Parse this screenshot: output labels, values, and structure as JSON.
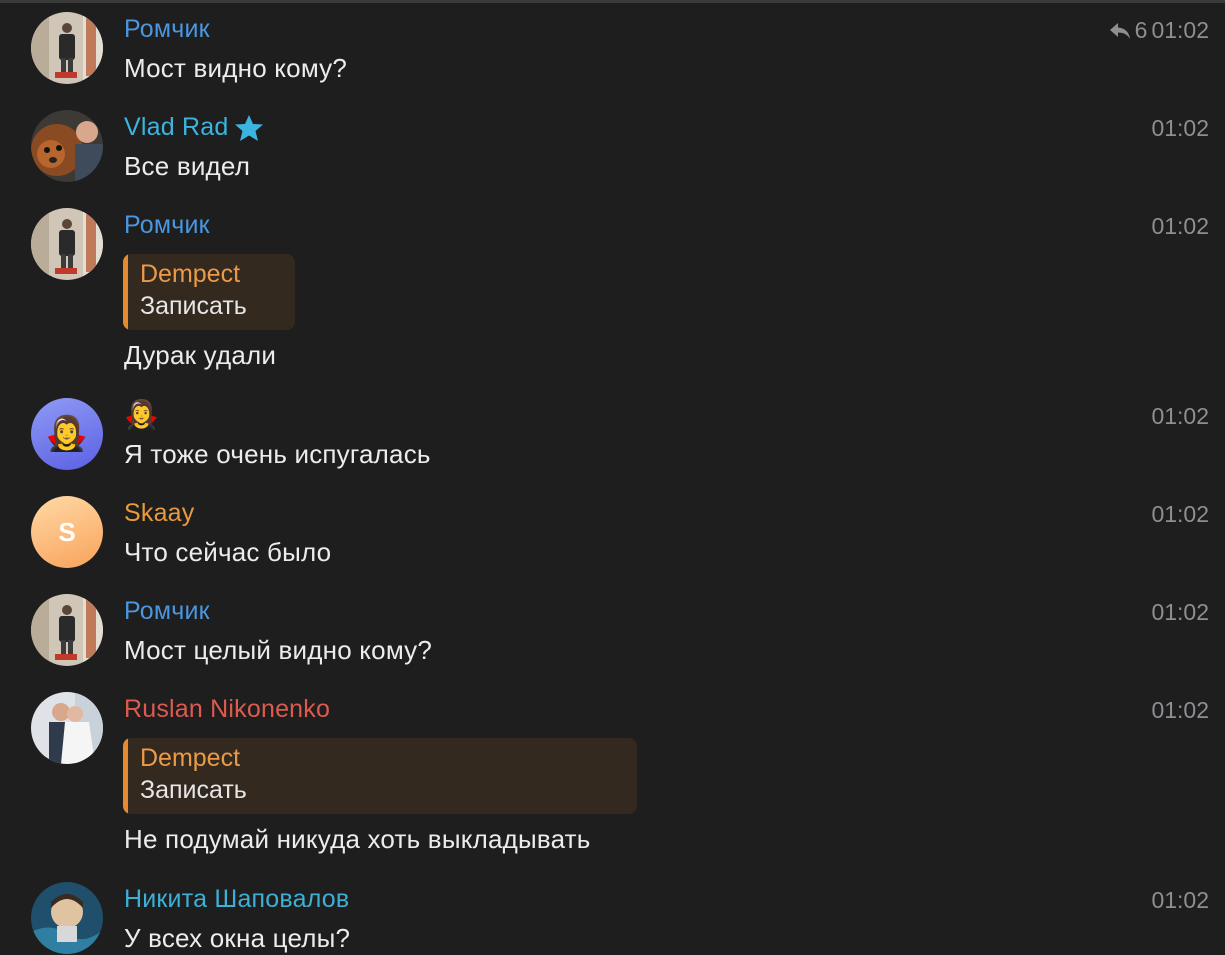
{
  "colors": {
    "background": "#1e1e1e",
    "romchik": "#4a96e0",
    "vlad": "#3bb5e0",
    "skaay": "#e99a3c",
    "ruslan": "#df5a4e",
    "nikita": "#3cb0d6",
    "quote_accent": "#e58a2e",
    "time": "#8e8e93"
  },
  "messages": [
    {
      "sender": "Ромчик",
      "time": "01:02",
      "reply_count": "6",
      "reply_icon": "reply-arrow-icon",
      "text": "Мост видно кому?"
    },
    {
      "sender": "Vlad Rad",
      "badge": "star-icon",
      "time": "01:02",
      "text": "Все видел"
    },
    {
      "sender": "Ромчик",
      "time": "01:02",
      "quote": {
        "name": "Dempect",
        "text": "Записать"
      },
      "text": "Дурак удали"
    },
    {
      "sender": "🧛‍♀️",
      "time": "01:02",
      "text": "Я тоже очень испугалась",
      "avatar_emoji": "🧛‍♀️"
    },
    {
      "sender": "Skaay",
      "time": "01:02",
      "text": "Что сейчас было",
      "avatar_letter": "S"
    },
    {
      "sender": "Ромчик",
      "time": "01:02",
      "text": "Мост целый видно кому?"
    },
    {
      "sender": "Ruslan Nikonenko",
      "time": "01:02",
      "quote": {
        "name": "Dempect",
        "text": "Записать"
      },
      "text": "Не подумай никуда хоть выкладывать"
    },
    {
      "sender": "Никита Шаповалов",
      "time": "01:02",
      "text": "У всех окна целы?"
    }
  ]
}
